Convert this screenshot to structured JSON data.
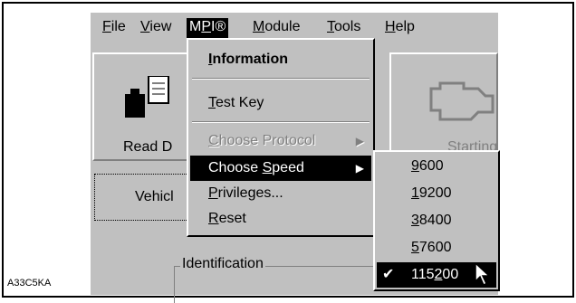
{
  "figure_id": "A33C5KA",
  "menubar": [
    {
      "label": "File",
      "key": "F",
      "rest": "ile"
    },
    {
      "label": "View",
      "key": "V",
      "rest": "iew"
    },
    {
      "label": "MPI®",
      "pre": "M",
      "key": "P",
      "rest": "I®"
    },
    {
      "label": "Module",
      "key": "M",
      "rest": "odule"
    },
    {
      "label": "Tools",
      "key": "T",
      "rest": "ools"
    },
    {
      "label": "Help",
      "key": "H",
      "rest": "elp"
    }
  ],
  "toolbar": {
    "read_button_label": "Read D",
    "starting_button_label": "Starting"
  },
  "tabs": {
    "vehicle_label": "Vehicl"
  },
  "groups": {
    "identification_label": "Identification"
  },
  "mpi_menu": {
    "information": {
      "label": "Information",
      "key": "I",
      "rest": "nformation"
    },
    "test_key": {
      "label": "Test Key",
      "key": "T",
      "rest": "est Key"
    },
    "choose_protocol": {
      "label": "Choose Protocol",
      "key": "C",
      "rest": "hoose Protocol",
      "enabled": false
    },
    "choose_speed": {
      "label": "Choose Speed",
      "pre": "Choose ",
      "key": "S",
      "rest": "peed",
      "highlighted": true
    },
    "privileges": {
      "label": "Privileges...",
      "key": "P",
      "rest": "rivileges..."
    },
    "reset": {
      "label": "Reset",
      "key": "R",
      "rest": "eset"
    }
  },
  "speed_menu": {
    "options": [
      {
        "label": "9600",
        "key": "9",
        "rest": "600"
      },
      {
        "label": "19200",
        "key": "1",
        "rest": "9200"
      },
      {
        "label": "38400",
        "key": "3",
        "rest": "8400"
      },
      {
        "label": "57600",
        "key": "5",
        "rest": "7600"
      },
      {
        "label": "115200",
        "pre": "115",
        "key": "2",
        "rest": "00"
      }
    ],
    "selected": "115200",
    "check_glyph": "✔"
  },
  "colors": {
    "face": "#c0c0c0",
    "highlight": "#000000",
    "highlight_text": "#ffffff",
    "disabled": "#808080"
  },
  "icons": {
    "read_button": "vehicle-interface-icon",
    "starting_button": "engine-icon",
    "submenu": "submenu-arrow-icon",
    "cursor": "mouse-pointer-icon"
  }
}
